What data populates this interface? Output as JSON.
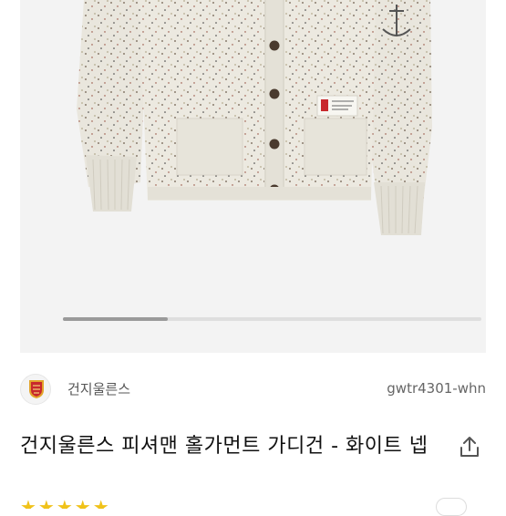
{
  "product": {
    "image_alt_icon": "cardigan-product-photo",
    "gallery_progress": 0.25
  },
  "brand": {
    "name": "건지울른스",
    "logo_icon": "shield-crest-icon"
  },
  "sku": "gwtr4301-whn",
  "title": "건지울른스 피셔맨 홀가먼트 가디건 - 화이트 넵",
  "share_icon": "share-icon",
  "rating": {
    "stars_shown": "★★★★★"
  },
  "colors": {
    "star": "#f0c21a",
    "crest_red": "#c8282c",
    "crest_gold": "#e2a52b"
  }
}
